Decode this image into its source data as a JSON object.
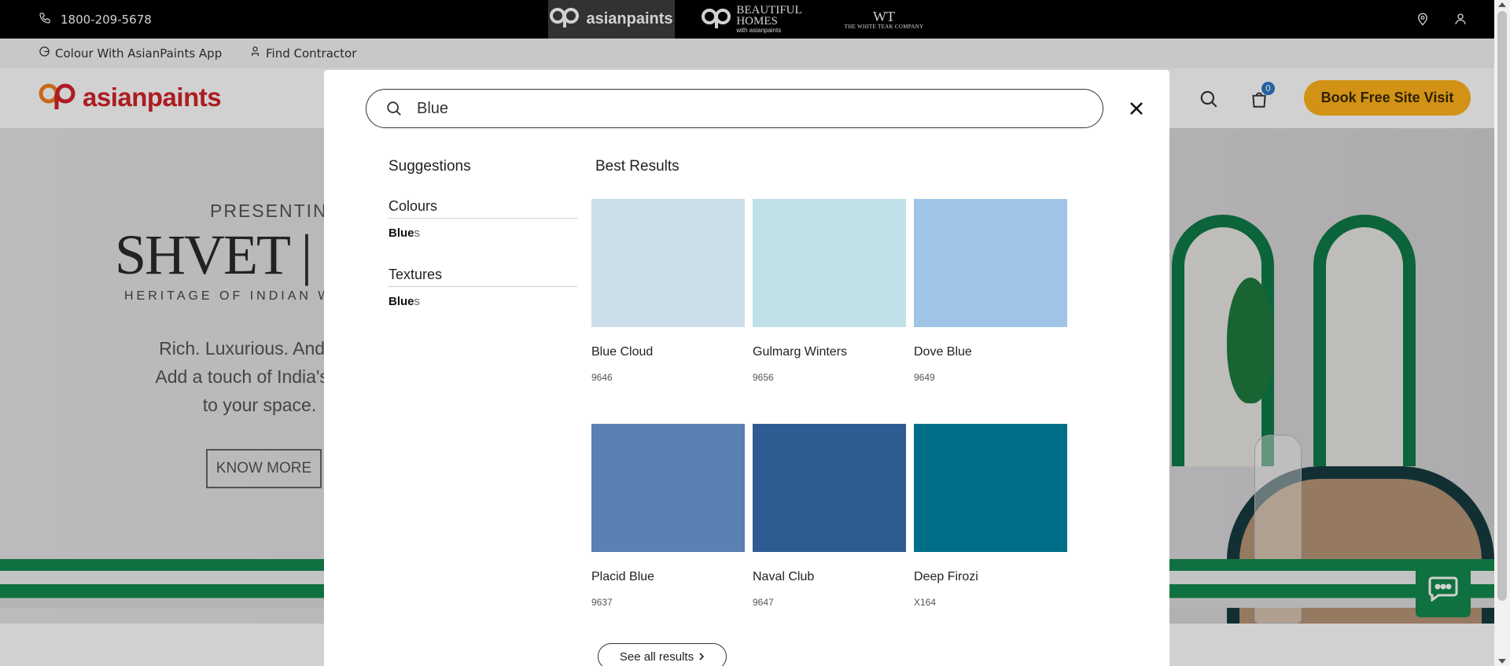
{
  "topbar": {
    "phone": "1800-209-5678",
    "brands": [
      {
        "name": "asianpaints"
      },
      {
        "name_line1": "BEAUTIFUL",
        "name_line2": "HOMES",
        "sub": "with asianpaints"
      },
      {
        "mono": "WT",
        "sub": "THE WHITE TEAK COMPANY"
      }
    ]
  },
  "utilbar": {
    "app_link": "Colour With AsianPaints App",
    "contractor_link": "Find Contractor"
  },
  "mainnav": {
    "logo_text": "asianpaints",
    "cart_count": "0",
    "book_button": "Book Free Site Visit"
  },
  "hero": {
    "presenting": "PRESENTING",
    "title": "SHVET | S",
    "heritage": "HERITAGE OF INDIAN WHITE",
    "tagline_lines": [
      "Rich. Luxurious. And und",
      "Add a touch of India's opu",
      "to your space."
    ],
    "cta": "KNOW MORE"
  },
  "search": {
    "query": "Blue",
    "suggestions_title": "Suggestions",
    "best_results_title": "Best Results",
    "groups": [
      {
        "title": "Colours",
        "item_match": "Blue",
        "item_rest": "s"
      },
      {
        "title": "Textures",
        "item_match": "Blue",
        "item_rest": "s"
      }
    ],
    "results": [
      {
        "name": "Blue Cloud",
        "code": "9646",
        "color": "#ccdeea"
      },
      {
        "name": "Gulmarg Winters",
        "code": "9656",
        "color": "#c0e0e8"
      },
      {
        "name": "Dove Blue",
        "code": "9649",
        "color": "#a0c4e6"
      },
      {
        "name": "Placid Blue",
        "code": "9637",
        "color": "#5b80b4"
      },
      {
        "name": "Naval Club",
        "code": "9647",
        "color": "#2f5b93"
      },
      {
        "name": "Deep Firozi",
        "code": "X164",
        "color": "#006e88"
      }
    ],
    "see_all": "See all results"
  },
  "colors": {
    "brand_red": "#d2232a",
    "book_button": "#ffb31b",
    "chat_green": "#138a4d"
  },
  "icons": {
    "phone": "phone-icon",
    "location": "location-pin-icon",
    "user": "user-icon",
    "search": "search-icon",
    "cart": "shopping-bag-icon",
    "close": "close-icon",
    "chat": "chat-bubble-icon"
  }
}
